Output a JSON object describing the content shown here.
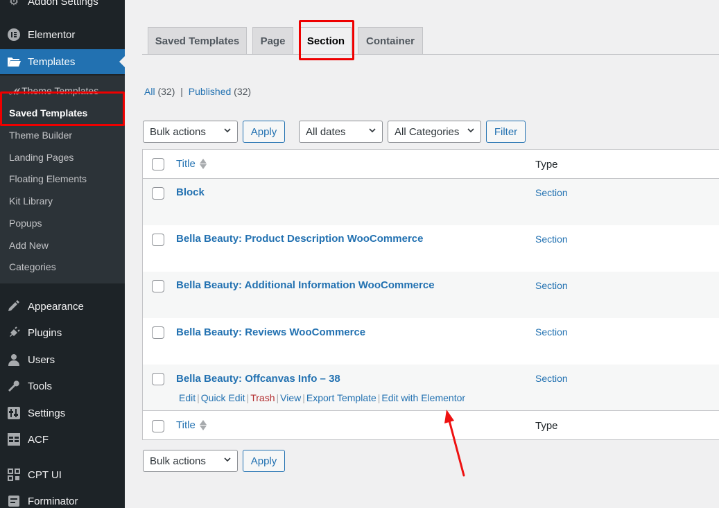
{
  "sidebar": {
    "items": [
      {
        "label": "Addon Settings",
        "icon": "gear-icon"
      },
      {
        "label": "Elementor",
        "icon": "elementor-icon"
      },
      {
        "label": "Templates",
        "icon": "folder-icon"
      },
      {
        "label": "Appearance",
        "icon": "brush-icon"
      },
      {
        "label": "Plugins",
        "icon": "plug-icon"
      },
      {
        "label": "Users",
        "icon": "user-icon"
      },
      {
        "label": "Tools",
        "icon": "wrench-icon"
      },
      {
        "label": "Settings",
        "icon": "sliders-icon"
      },
      {
        "label": "ACF",
        "icon": "table-icon"
      },
      {
        "label": "CPT UI",
        "icon": "grid-icon"
      },
      {
        "label": "Forminator",
        "icon": "form-icon"
      }
    ],
    "submenu": [
      "Theme Templates",
      "Saved Templates",
      "Theme Builder",
      "Landing Pages",
      "Floating Elements",
      "Kit Library",
      "Popups",
      "Add New",
      "Categories"
    ]
  },
  "tabs": [
    "Saved Templates",
    "Page",
    "Section",
    "Container"
  ],
  "views": {
    "all": "All",
    "all_count": "(32)",
    "sep": "|",
    "published": "Published",
    "published_count": "(32)"
  },
  "filters": {
    "bulk": "Bulk actions",
    "apply": "Apply",
    "dates": "All dates",
    "categories": "All Categories",
    "filter": "Filter"
  },
  "table": {
    "col_title": "Title",
    "col_type": "Type",
    "rows": [
      {
        "title": "Block",
        "type": "Section"
      },
      {
        "title": "Bella Beauty: Product Description WooCommerce",
        "type": "Section"
      },
      {
        "title": "Bella Beauty: Additional Information WooCommerce",
        "type": "Section"
      },
      {
        "title": "Bella Beauty: Reviews WooCommerce",
        "type": "Section"
      },
      {
        "title": "Bella Beauty: Offcanvas Info – 38",
        "type": "Section"
      }
    ],
    "row_actions": {
      "edit": "Edit",
      "quick_edit": "Quick Edit",
      "trash": "Trash",
      "view": "View",
      "export": "Export Template",
      "edit_elementor": "Edit with Elementor",
      "sep": "|"
    }
  },
  "colors": {
    "accent": "#2271b1",
    "highlight": "#ee0000",
    "sidebar": "#1d2327"
  }
}
